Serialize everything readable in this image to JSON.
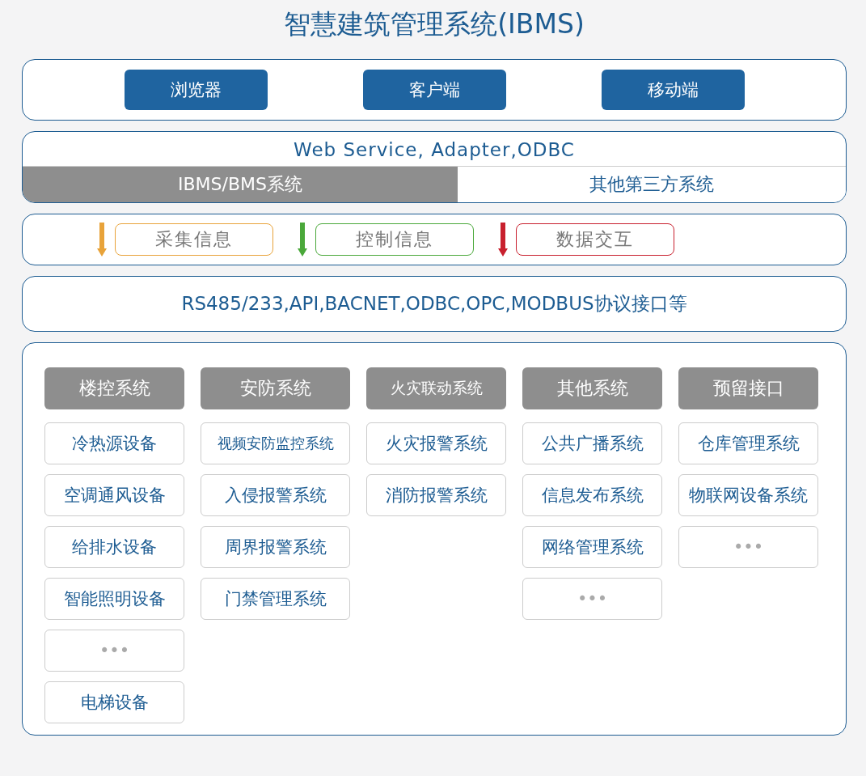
{
  "title": "智慧建筑管理系统(IBMS)",
  "clients": [
    "浏览器",
    "客户端",
    "移动端"
  ],
  "middleware": {
    "heading": "Web Service, Adapter,ODBC",
    "systems": [
      {
        "label": "IBMS/BMS系统",
        "selected": true
      },
      {
        "label": "其他第三方系统",
        "selected": false
      }
    ]
  },
  "flows": [
    {
      "label": "采集信息",
      "color": "#e8a33a"
    },
    {
      "label": "控制信息",
      "color": "#4aa83a"
    },
    {
      "label": "数据交互",
      "color": "#c8202e"
    }
  ],
  "protocols": "RS485/233,API,BACNET,ODBC,OPC,MODBUS协议接口等",
  "subsystems": [
    {
      "title": "楼控系统",
      "items": [
        "冷热源设备",
        "空调通风设备",
        "给排水设备",
        "智能照明设备",
        "•••",
        "电梯设备"
      ]
    },
    {
      "title": "安防系统",
      "items": [
        "视频安防监控系统",
        "入侵报警系统",
        "周界报警系统",
        "门禁管理系统"
      ]
    },
    {
      "title": "火灾联动系统",
      "items": [
        "火灾报警系统",
        "消防报警系统"
      ]
    },
    {
      "title": "其他系统",
      "items": [
        "公共广播系统",
        "信息发布系统",
        "网络管理系统",
        "•••"
      ]
    },
    {
      "title": "预留接口",
      "items": [
        "仓库管理系统",
        "物联网设备系统",
        "•••"
      ]
    }
  ]
}
